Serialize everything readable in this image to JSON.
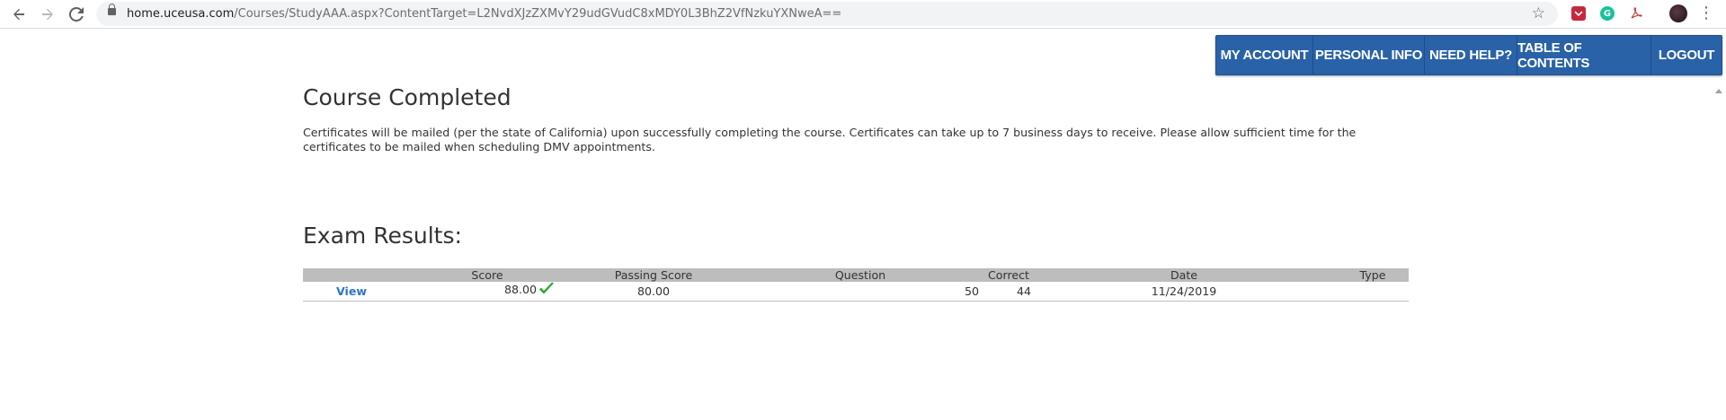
{
  "browser": {
    "url_host": "home.uceusa.com",
    "url_path": "/Courses/StudyAAA.aspx?ContentTarget=L2NvdXJzZXMvY29udGVudC8xMDY0L3BhZ2VfNzkuYXNweA==",
    "icons": [
      "back-icon",
      "forward-icon",
      "reload-icon",
      "lock-icon",
      "star-icon",
      "extension-icons",
      "profile-avatar",
      "menu-icon"
    ]
  },
  "topnav": {
    "items": [
      "MY ACCOUNT",
      "PERSONAL INFO",
      "NEED HELP?",
      "TABLE OF CONTENTS",
      "LOGOUT"
    ],
    "color": "#2a62a8"
  },
  "course": {
    "title": "Course Completed",
    "message": "Certificates will be mailed (per the state of California) upon successfully completing the course. Certificates can take up to 7 business days to receive. Please allow sufficient time for the certificates to be mailed when scheduling DMV appointments."
  },
  "exam": {
    "title": "Exam Results:",
    "columns": [
      "",
      "Score",
      "Passing Score",
      "Question",
      "Correct",
      "Date",
      "Type"
    ],
    "rows": [
      {
        "link": "View",
        "score": "88.00",
        "passing_score": "80.00",
        "question": "50",
        "correct": "44",
        "date": "11/24/2019",
        "type": ""
      }
    ],
    "pass_color": "#2fa52f"
  }
}
